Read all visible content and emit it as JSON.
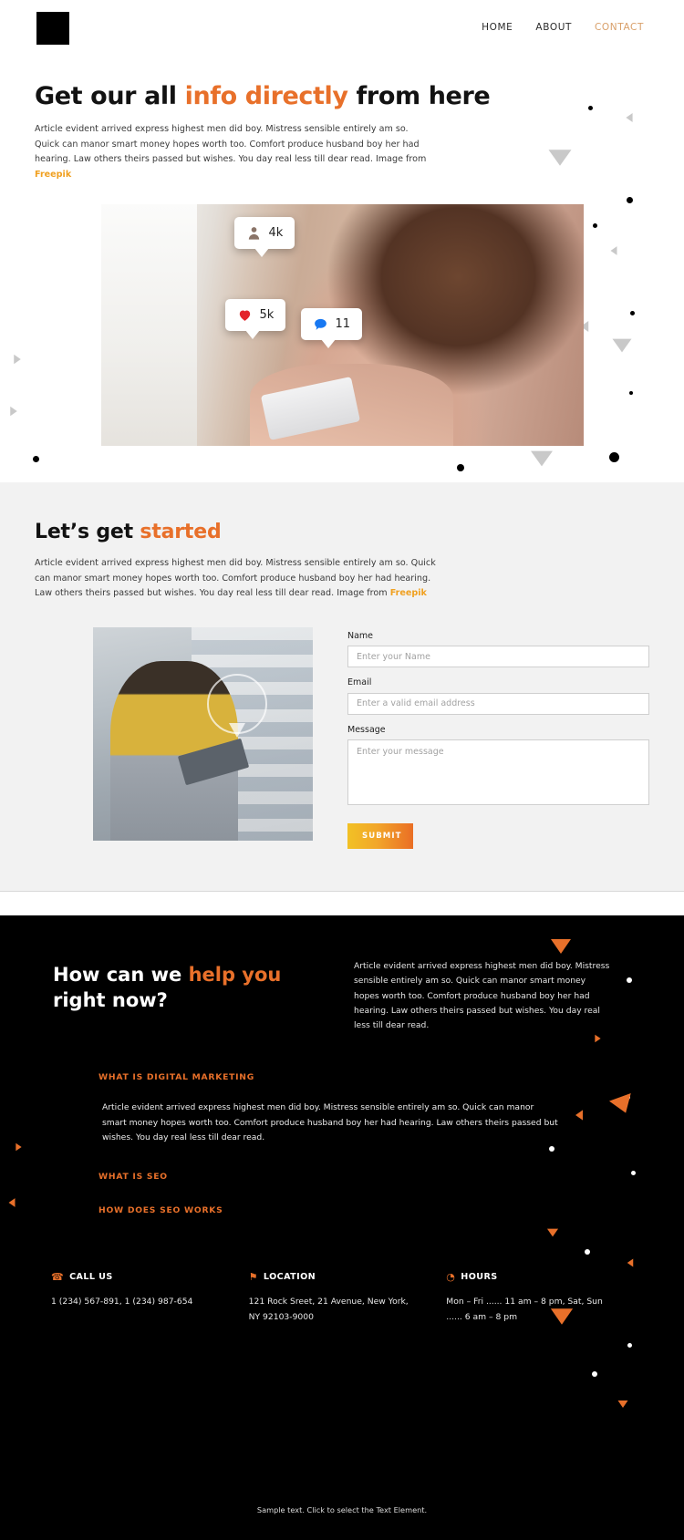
{
  "header": {
    "logo_name": "logo-mark",
    "nav": [
      {
        "label": "HOME",
        "active": false
      },
      {
        "label": "ABOUT",
        "active": false
      },
      {
        "label": "CONTACT",
        "active": true
      }
    ]
  },
  "hero": {
    "title_1": "Get our all ",
    "title_accent": "info directly",
    "title_2": " from here",
    "paragraph": "Article evident arrived express highest men did boy. Mistress sensible entirely am so. Quick can manor smart money hopes worth too. Comfort produce husband boy her had hearing. Law others theirs passed but wishes. You day real less till dear read. Image from ",
    "link_label": "Freepik",
    "badges": [
      {
        "icon": "person-icon",
        "value": "4k"
      },
      {
        "icon": "heart-icon",
        "value": "5k"
      },
      {
        "icon": "comment-icon",
        "value": "11"
      }
    ]
  },
  "started": {
    "title_1": "Let’s get ",
    "title_accent": "started",
    "paragraph": "Article evident arrived express highest men did boy. Mistress sensible entirely am so. Quick can manor smart money hopes worth too. Comfort produce husband boy her had hearing. Law others theirs passed but wishes. You day real less till dear read. Image from ",
    "link_label": "Freepik",
    "form": {
      "name_label": "Name",
      "name_placeholder": "Enter your Name",
      "name_value": "",
      "email_label": "Email",
      "email_placeholder": "Enter a valid email address",
      "email_value": "",
      "message_label": "Message",
      "message_placeholder": "Enter your message",
      "message_value": "",
      "submit_label": "SUBMIT"
    }
  },
  "dark": {
    "title_1": "How can we ",
    "title_accent": "help you",
    "title_2": "right now?",
    "lead": "Article evident arrived express highest men did boy. Mistress sensible entirely am so. Quick can manor smart money hopes worth too. Comfort produce husband boy her had hearing. Law others theirs passed but wishes. You day real less till dear read.",
    "accordion": [
      {
        "title": "WHAT IS DIGITAL MARKETING",
        "body": "Article evident arrived express highest men did boy. Mistress sensible entirely am so. Quick can manor smart money hopes worth too. Comfort produce husband boy her had hearing. Law others theirs passed but wishes. You day real less till dear read.",
        "open": true
      },
      {
        "title": "WHAT IS SEO",
        "body": "",
        "open": false
      },
      {
        "title": "HOW DOES SEO WORKS",
        "body": "",
        "open": false
      }
    ],
    "contact": [
      {
        "icon": "phone-icon",
        "glyph": "☎",
        "heading": "CALL US",
        "text": "1 (234) 567-891, 1 (234) 987-654"
      },
      {
        "icon": "location-pin-icon",
        "glyph": "⚑",
        "heading": "LOCATION",
        "text": "121 Rock Sreet, 21 Avenue, New York, NY 92103-9000"
      },
      {
        "icon": "clock-icon",
        "glyph": "◔",
        "heading": "HOURS",
        "text": "Mon – Fri ...... 11 am – 8 pm, Sat, Sun  ...... 6 am – 8 pm"
      }
    ],
    "note": "Sample text. Click to select the Text Element."
  },
  "colors": {
    "accent_orange": "#e8702a",
    "link_amber": "#f0a020",
    "nav_active": "#d9a06a",
    "dark_bg": "#000000",
    "light_bg": "#f2f2f2"
  }
}
